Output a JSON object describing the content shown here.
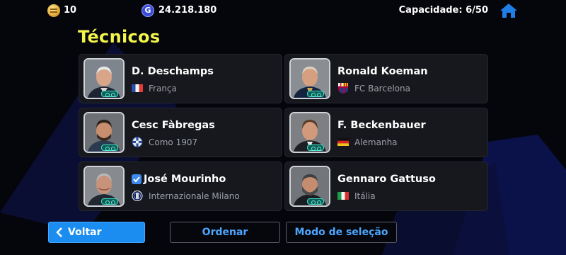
{
  "topbar": {
    "coins": "10",
    "gp": "24.218.180",
    "gp_icon_letter": "G",
    "capacity": "Capacidade: 6/50",
    "home_icon": "home-icon"
  },
  "section_title": "Técnicos",
  "coaches": [
    {
      "name": "D. Deschamps",
      "team": "França",
      "team_icon": "flag-france",
      "selected": false
    },
    {
      "name": "Ronald Koeman",
      "team": "FC Barcelona",
      "team_icon": "crest-fc-barcelona",
      "selected": false
    },
    {
      "name": "Cesc Fàbregas",
      "team": "Como 1907",
      "team_icon": "crest-como-1907",
      "selected": false
    },
    {
      "name": "F. Beckenbauer",
      "team": "Alemanha",
      "team_icon": "flag-germany",
      "selected": false
    },
    {
      "name": "José Mourinho",
      "team": "Internazionale Milano",
      "team_icon": "crest-internazionale",
      "selected": true
    },
    {
      "name": "Gennaro Gattuso",
      "team": "Itália",
      "team_icon": "flag-italy",
      "selected": false
    }
  ],
  "buttons": {
    "back": "Voltar",
    "sort": "Ordenar",
    "selection_mode": "Modo de seleção"
  },
  "colors": {
    "title": "#f2f54a",
    "accent_blue": "#1b8df0",
    "link_blue": "#4ea6ff",
    "card_bg": "#16181d"
  }
}
